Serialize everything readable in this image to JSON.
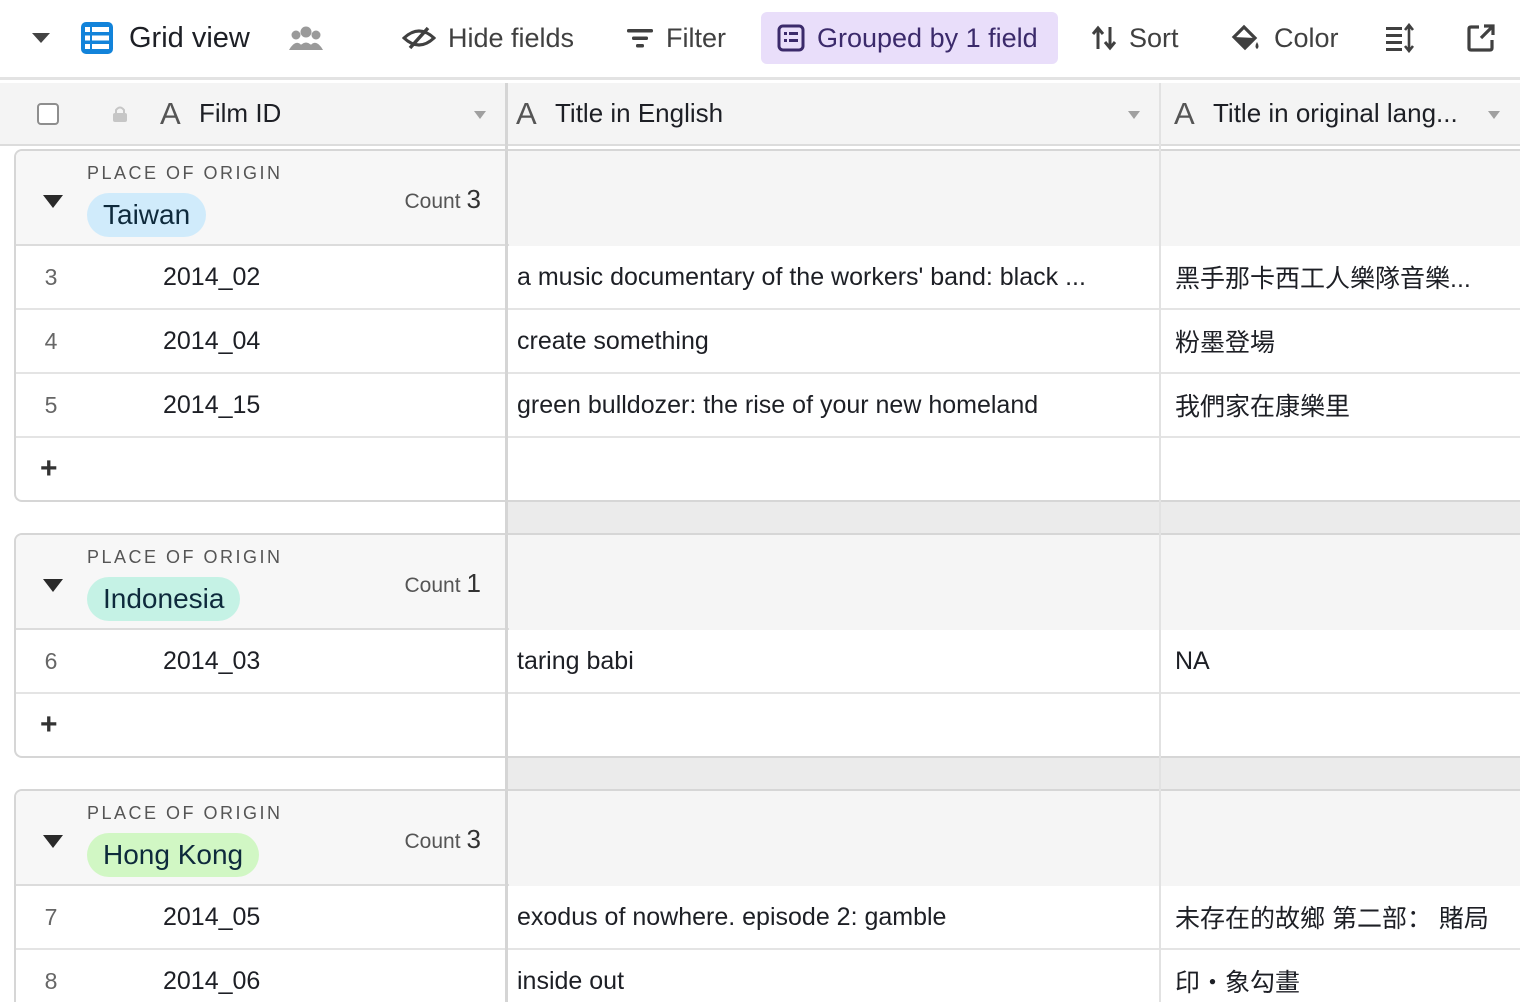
{
  "toolbar": {
    "view_name": "Grid view",
    "hide_fields": "Hide fields",
    "filter": "Filter",
    "grouped": "Grouped by 1 field",
    "sort": "Sort",
    "color": "Color"
  },
  "columns": {
    "film_id": "Film ID",
    "title_en": "Title in English",
    "title_orig": "Title in original lang..."
  },
  "group_field_label": "PLACE OF ORIGIN",
  "count_label": "Count",
  "add_symbol": "+",
  "groups": [
    {
      "name": "Taiwan",
      "pill_color": "#d0ebfb",
      "count": "3",
      "rows": [
        {
          "num": "3",
          "film_id": "2014_02",
          "title_en": "a music documentary of the workers' band: black ...",
          "title_orig": "黑手那卡西工人樂隊音樂..."
        },
        {
          "num": "4",
          "film_id": "2014_04",
          "title_en": "create something",
          "title_orig": "粉墨登場"
        },
        {
          "num": "5",
          "film_id": "2014_15",
          "title_en": "green bulldozer: the rise of your new homeland",
          "title_orig": "我們家在康樂里"
        }
      ]
    },
    {
      "name": "Indonesia",
      "pill_color": "#c5f2e5",
      "count": "1",
      "rows": [
        {
          "num": "6",
          "film_id": "2014_03",
          "title_en": "taring babi",
          "title_orig": "NA"
        }
      ]
    },
    {
      "name": "Hong Kong",
      "pill_color": "#d1f7c4",
      "count": "3",
      "rows": [
        {
          "num": "7",
          "film_id": "2014_05",
          "title_en": "exodus of nowhere. episode 2: gamble",
          "title_orig": "未存在的故鄉 第二部： 賭局"
        },
        {
          "num": "8",
          "film_id": "2014_06",
          "title_en": "inside out",
          "title_orig": "印・象勾畫"
        }
      ]
    }
  ]
}
